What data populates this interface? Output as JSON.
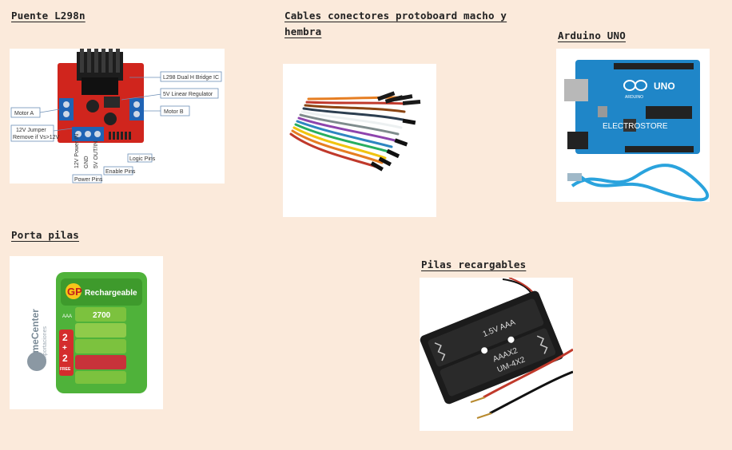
{
  "captions": {
    "l298n": "Puente L298n",
    "cables": "Cables conectores protoboard macho y hembra",
    "arduino": "Arduino UNO",
    "porta_pilas": "Porta pilas",
    "pilas": "Pilas recargables"
  },
  "l298n_labels": {
    "bridge": "L298 Dual H Bridge IC",
    "regulator": "5V Linear Regulator",
    "motor_a": "Motor A",
    "motor_b": "Motor B",
    "jumper_line1": "12V Jumper",
    "jumper_line2": "Remove if Vs>12V",
    "pin_12v": "12V Power IN",
    "pin_gnd": "GND",
    "pin_5v": "5V OUT/IN",
    "logic_pins": "Logic Pins",
    "enable_pins": "Enable Pins",
    "power_pins": "Power Pins"
  },
  "arduino_labels": {
    "logo": "UNO",
    "brand": "ELECTROSTORE",
    "made": "ARDUINO"
  },
  "battery_labels": {
    "brand": "GP",
    "product": "Rechargeable",
    "capacity": "2700",
    "type": "AAA",
    "promo_top": "2",
    "promo_plus": "+",
    "promo_bottom": "2",
    "promo_free": "FREE",
    "side_brand": "TimeCenter",
    "side_sub": "Importaciones"
  },
  "holder_labels": {
    "line1": "1.5V AAA",
    "line2": "AAAX2",
    "line3": "UM-4X2"
  },
  "colors": {
    "background": "#fbeadb",
    "board_red": "#d0251d",
    "terminal_blue": "#1f63b4",
    "arduino_blue": "#1f86c8",
    "battery_green": "#4fb23a"
  }
}
